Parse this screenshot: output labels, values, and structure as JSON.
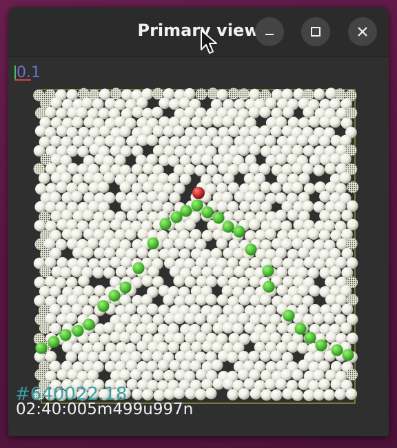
{
  "window": {
    "title": "Primary view",
    "controls": [
      "minimize-icon",
      "maximize-icon",
      "close-icon"
    ]
  },
  "viewport": {
    "scale_label": "0.1",
    "frame_id": "#640022.18",
    "timestamp": "02:40:005m499u997n",
    "colors": {
      "background": "#2f2f2f",
      "particle": "#f4f4ec",
      "boundary_particle": "#d8d8c8",
      "path_particle": "#4fc236",
      "selected_particle": "#c62c2c",
      "box_outline": "#c8c23a",
      "frame_id_text": "#3c9fa6",
      "scale_text": "#6b6fd6"
    }
  }
}
